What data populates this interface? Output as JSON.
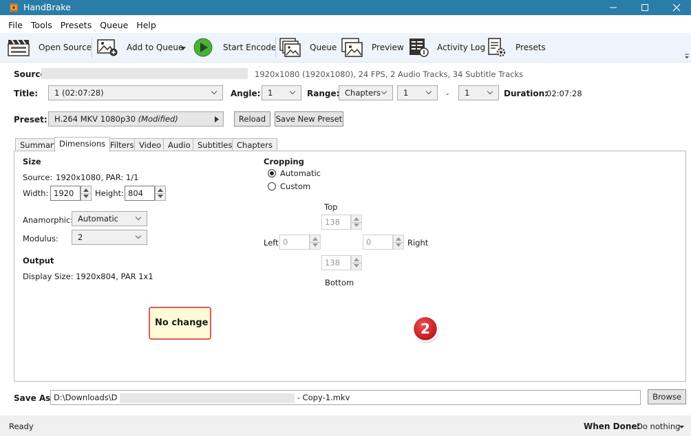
{
  "window": {
    "title": "HandBrake"
  },
  "menu": [
    "File",
    "Tools",
    "Presets",
    "Queue",
    "Help"
  ],
  "toolbar": {
    "open_source": "Open Source",
    "add_to_queue": "Add to Queue",
    "start_encode": "Start Encode",
    "queue": "Queue",
    "preview": "Preview",
    "activity_log": "Activity Log",
    "presets": "Presets"
  },
  "source": {
    "label": "Source:",
    "info": "1920x1080 (1920x1080), 24 FPS, 2 Audio Tracks, 34 Subtitle Tracks"
  },
  "title_row": {
    "title_label": "Title:",
    "title_value": "1  (02:07:28)",
    "angle_label": "Angle:",
    "angle_value": "1",
    "range_label": "Range:",
    "range_type": "Chapters",
    "range_start": "1",
    "range_dash": "-",
    "range_end": "1",
    "duration_label": "Duration:",
    "duration_value": "02:07:28"
  },
  "preset_row": {
    "label": "Preset:",
    "name": "H.264 MKV 1080p30",
    "modified": "(Modified)",
    "reload": "Reload",
    "save_new": "Save New Preset"
  },
  "tabs": [
    "Summary",
    "Dimensions",
    "Filters",
    "Video",
    "Audio",
    "Subtitles",
    "Chapters"
  ],
  "active_tab": "Dimensions",
  "size": {
    "heading": "Size",
    "source_label": "Source:",
    "source_value": "1920x1080, PAR: 1/1",
    "width_label": "Width:",
    "width_value": "1920",
    "height_label": "Height:",
    "height_value": "804",
    "anamorphic_label": "Anamorphic:",
    "anamorphic_value": "Automatic",
    "modulus_label": "Modulus:",
    "modulus_value": "2"
  },
  "output": {
    "heading": "Output",
    "display_size": "Display Size: 1920x804,  PAR 1x1"
  },
  "cropping": {
    "heading": "Cropping",
    "automatic": "Automatic",
    "custom": "Custom",
    "selected": "Automatic",
    "top_label": "Top",
    "top_value": "138",
    "left_label": "Left",
    "left_value": "0",
    "right_label": "Right",
    "right_value": "0",
    "bottom_label": "Bottom",
    "bottom_value": "138"
  },
  "annotation": {
    "callout_text": "No change",
    "step_number": "2",
    "badge_color": "#d8282a"
  },
  "save_as": {
    "label": "Save As:",
    "path_prefix": "D:\\Downloads\\D",
    "path_suffix": "- Copy-1.mkv",
    "browse": "Browse"
  },
  "status": {
    "text": "Ready",
    "when_done_label": "When Done:",
    "when_done_value": "Do nothing"
  },
  "colors": {
    "titlebar": "#2a7da8",
    "toolbar_bg": "#eef4fb",
    "play_green": "#4caf3a",
    "callout_border": "#e05a5a",
    "callout_bg": "#fffbd6"
  }
}
